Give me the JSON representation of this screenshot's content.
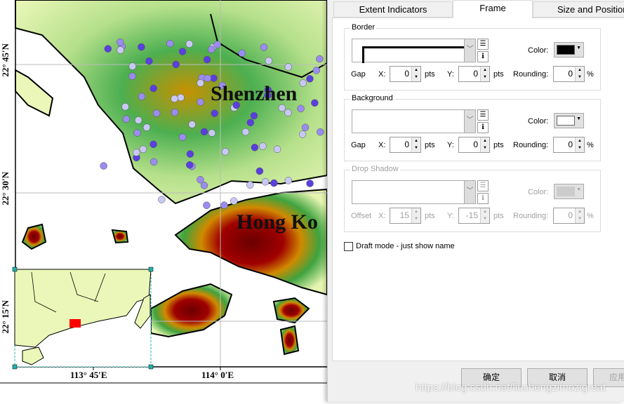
{
  "map": {
    "lat_labels": [
      "22° 45′N",
      "22° 30′N",
      "22° 15′N"
    ],
    "lon_labels": [
      "113° 45′E",
      "114° 0′E"
    ],
    "places": [
      "Shenzhen",
      "Hong Ko"
    ],
    "colors": {
      "lowland": "#e6f5b0",
      "forest": "#4caf50",
      "highland": "#d4a000",
      "peak": "#7a0000",
      "stations": "#7b68ee",
      "inset_highlight": "#ff0000",
      "selection_handle": "#20b2aa"
    }
  },
  "dialog": {
    "tabs": [
      {
        "label": "Extent Indicators"
      },
      {
        "label": "Frame",
        "active": true
      },
      {
        "label": "Size and Position"
      }
    ],
    "border": {
      "title": "Border",
      "color_label": "Color:",
      "color": "#000000",
      "gap_label": "Gap",
      "x_label": "X:",
      "x": "0",
      "y_label": "Y:",
      "y": "0",
      "units": "pts",
      "rounding_label": "Rounding:",
      "rounding": "0",
      "percent": "%"
    },
    "background": {
      "title": "Background",
      "color_label": "Color:",
      "color": "#ffffff",
      "gap_label": "Gap",
      "x_label": "X:",
      "x": "0",
      "y_label": "Y:",
      "y": "0",
      "units": "pts",
      "rounding_label": "Rounding:",
      "rounding": "0",
      "percent": "%"
    },
    "shadow": {
      "title": "Drop Shadow",
      "color_label": "Color:",
      "color": "#cccccc",
      "gap_label": "Offset",
      "x_label": "X:",
      "x": "15",
      "y_label": "Y:",
      "y": "-15",
      "units": "pts",
      "rounding_label": "Rounding:",
      "rounding": "0",
      "percent": "%"
    },
    "draft_mode": {
      "label": "Draft mode - just show name",
      "checked": false
    },
    "buttons": {
      "ok": "确定",
      "cancel": "取消",
      "apply": "应用"
    }
  },
  "watermark": "https://blog.csdn.net/liuchengzimozigreat"
}
